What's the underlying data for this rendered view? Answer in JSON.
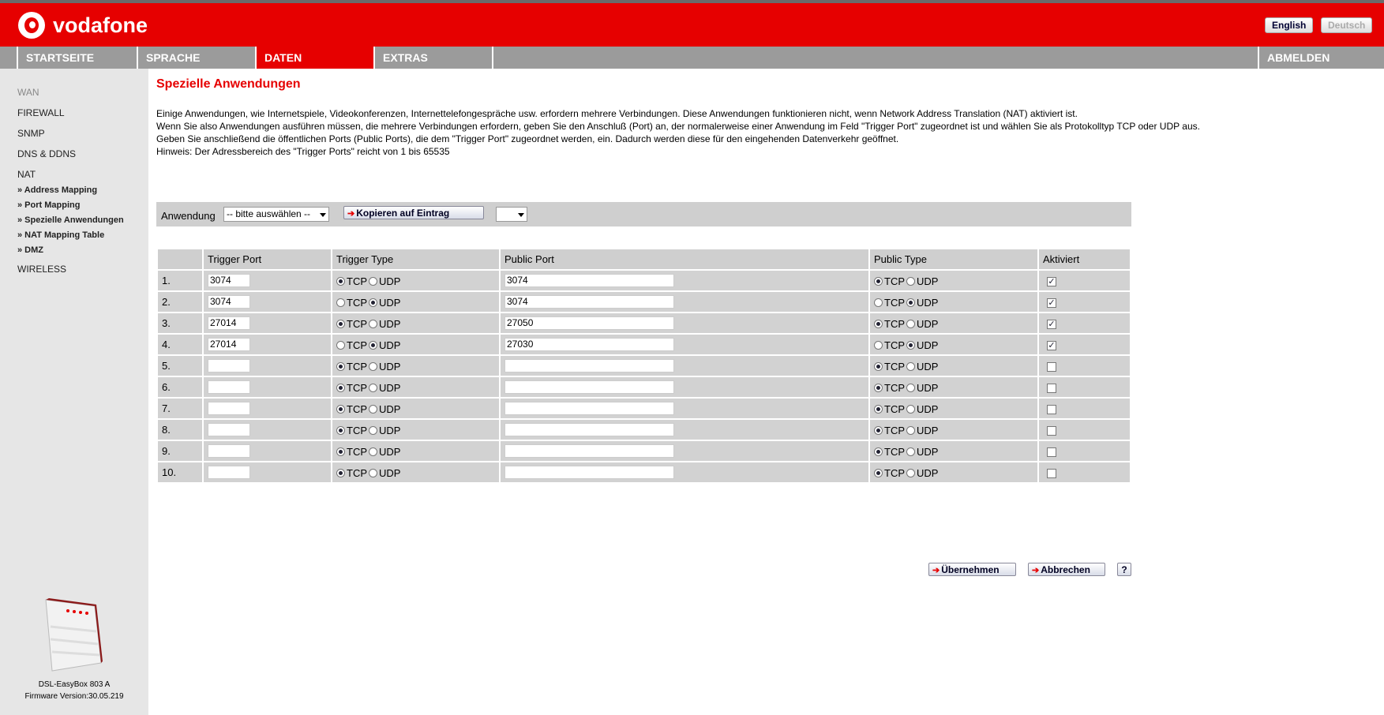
{
  "header": {
    "brand": "vodafone",
    "lang_english": "English",
    "lang_deutsch": "Deutsch"
  },
  "nav": {
    "items": [
      "STARTSEITE",
      "SPRACHE",
      "DATEN",
      "EXTRAS"
    ],
    "logout": "ABMELDEN",
    "active": "DATEN"
  },
  "sidebar": {
    "items": [
      "WAN",
      "FIREWALL",
      "SNMP",
      "DNS & DDNS",
      "NAT",
      "WIRELESS"
    ],
    "nat_sub": [
      "» Address Mapping",
      "» Port Mapping",
      "» Spezielle Anwendungen",
      "» NAT Mapping Table",
      "» DMZ"
    ],
    "device_name": "DSL-EasyBox 803 A",
    "firmware": "Firmware Version:30.05.219"
  },
  "page": {
    "title": "Spezielle Anwendungen",
    "desc": [
      "Einige Anwendungen, wie Internetspiele, Videokonferenzen, Internettelefongespräche usw. erfordern mehrere Verbindungen. Diese Anwendungen funktionieren nicht, wenn Network Address Translation (NAT) aktiviert ist.",
      "Wenn Sie also Anwendungen ausführen müssen, die mehrere Verbindungen erfordern, geben Sie den Anschluß (Port) an, der normalerweise einer Anwendung im Feld \"Trigger Port\" zugeordnet ist und wählen Sie als Protokolltyp TCP oder UDP aus.",
      "Geben Sie anschließend die öffentlichen Ports (Public Ports), die dem \"Trigger Port\" zugeordnet werden, ein. Dadurch werden diese für den eingehenden Datenverkehr geöffnet.",
      "Hinweis: Der Adressbereich des \"Trigger Ports\" reicht von 1 bis 65535"
    ]
  },
  "app": {
    "label": "Anwendung",
    "select_value": "-- bitte auswählen --",
    "copy_button": "Kopieren auf Eintrag",
    "entry_select_value": ""
  },
  "table": {
    "headers": [
      "",
      "Trigger Port",
      "Trigger Type",
      "Public Port",
      "Public Type",
      "Aktiviert"
    ],
    "tcp": "TCP",
    "udp": "UDP",
    "rows": [
      {
        "no": "1.",
        "trigger_port": "3074",
        "trigger_type": "TCP",
        "public_port": "3074",
        "public_type": "TCP",
        "enabled": true
      },
      {
        "no": "2.",
        "trigger_port": "3074",
        "trigger_type": "UDP",
        "public_port": "3074",
        "public_type": "UDP",
        "enabled": true
      },
      {
        "no": "3.",
        "trigger_port": "27014",
        "trigger_type": "TCP",
        "public_port": "27050",
        "public_type": "TCP",
        "enabled": true
      },
      {
        "no": "4.",
        "trigger_port": "27014",
        "trigger_type": "UDP",
        "public_port": "27030",
        "public_type": "UDP",
        "enabled": true
      },
      {
        "no": "5.",
        "trigger_port": "",
        "trigger_type": "TCP",
        "public_port": "",
        "public_type": "TCP",
        "enabled": false
      },
      {
        "no": "6.",
        "trigger_port": "",
        "trigger_type": "TCP",
        "public_port": "",
        "public_type": "TCP",
        "enabled": false
      },
      {
        "no": "7.",
        "trigger_port": "",
        "trigger_type": "TCP",
        "public_port": "",
        "public_type": "TCP",
        "enabled": false
      },
      {
        "no": "8.",
        "trigger_port": "",
        "trigger_type": "TCP",
        "public_port": "",
        "public_type": "TCP",
        "enabled": false
      },
      {
        "no": "9.",
        "trigger_port": "",
        "trigger_type": "TCP",
        "public_port": "",
        "public_type": "TCP",
        "enabled": false
      },
      {
        "no": "10.",
        "trigger_port": "",
        "trigger_type": "TCP",
        "public_port": "",
        "public_type": "TCP",
        "enabled": false
      }
    ]
  },
  "actions": {
    "apply": "Übernehmen",
    "cancel": "Abbrechen",
    "help": "?"
  },
  "colors": {
    "brand_red": "#e60000",
    "nav_gray": "#9b9b9b",
    "sidebar_bg": "#e6e6e6",
    "table_cell": "#d2d2d2"
  }
}
